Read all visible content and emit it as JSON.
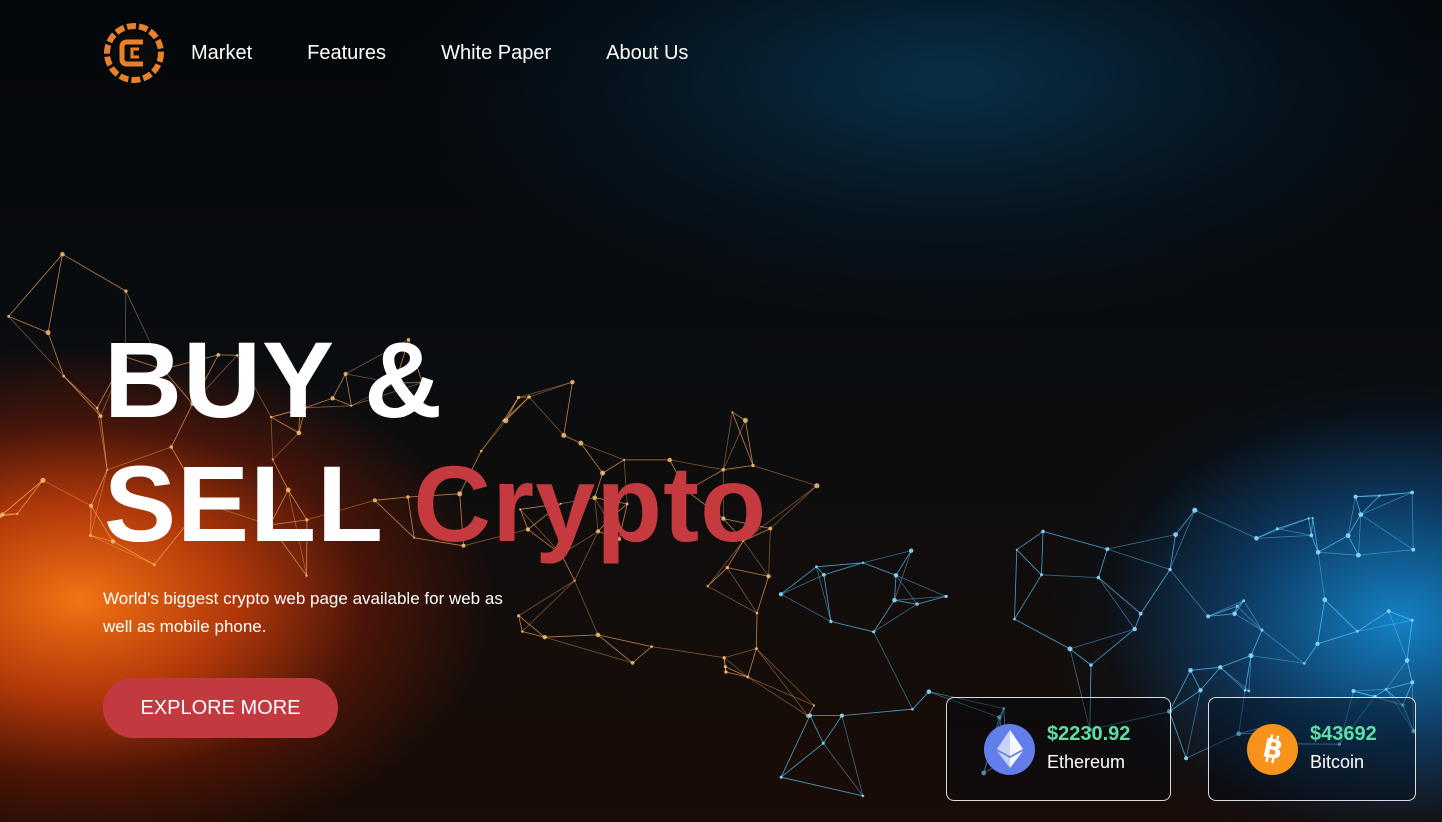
{
  "nav": {
    "logo_icon": "crypto-c-logo-icon",
    "links": [
      {
        "label": "Market"
      },
      {
        "label": "Features"
      },
      {
        "label": "White Paper"
      },
      {
        "label": "About Us"
      }
    ]
  },
  "hero": {
    "title_line1": "BUY &",
    "title_line2": "SELL",
    "title_accent": "Crypto",
    "subtitle": "World's biggest crypto web page available for web as well as mobile phone.",
    "cta_label": "EXPLORE MORE"
  },
  "prices": [
    {
      "price": "$2230.92",
      "name": "Ethereum",
      "icon": "ethereum-icon"
    },
    {
      "price": "$43692",
      "name": "Bitcoin",
      "icon": "bitcoin-icon"
    }
  ],
  "colors": {
    "accent": "#c23a3f",
    "price_green": "#5ee0a4",
    "logo_orange": "#e8822a",
    "ethereum": "#627eea",
    "bitcoin": "#f7931a"
  }
}
